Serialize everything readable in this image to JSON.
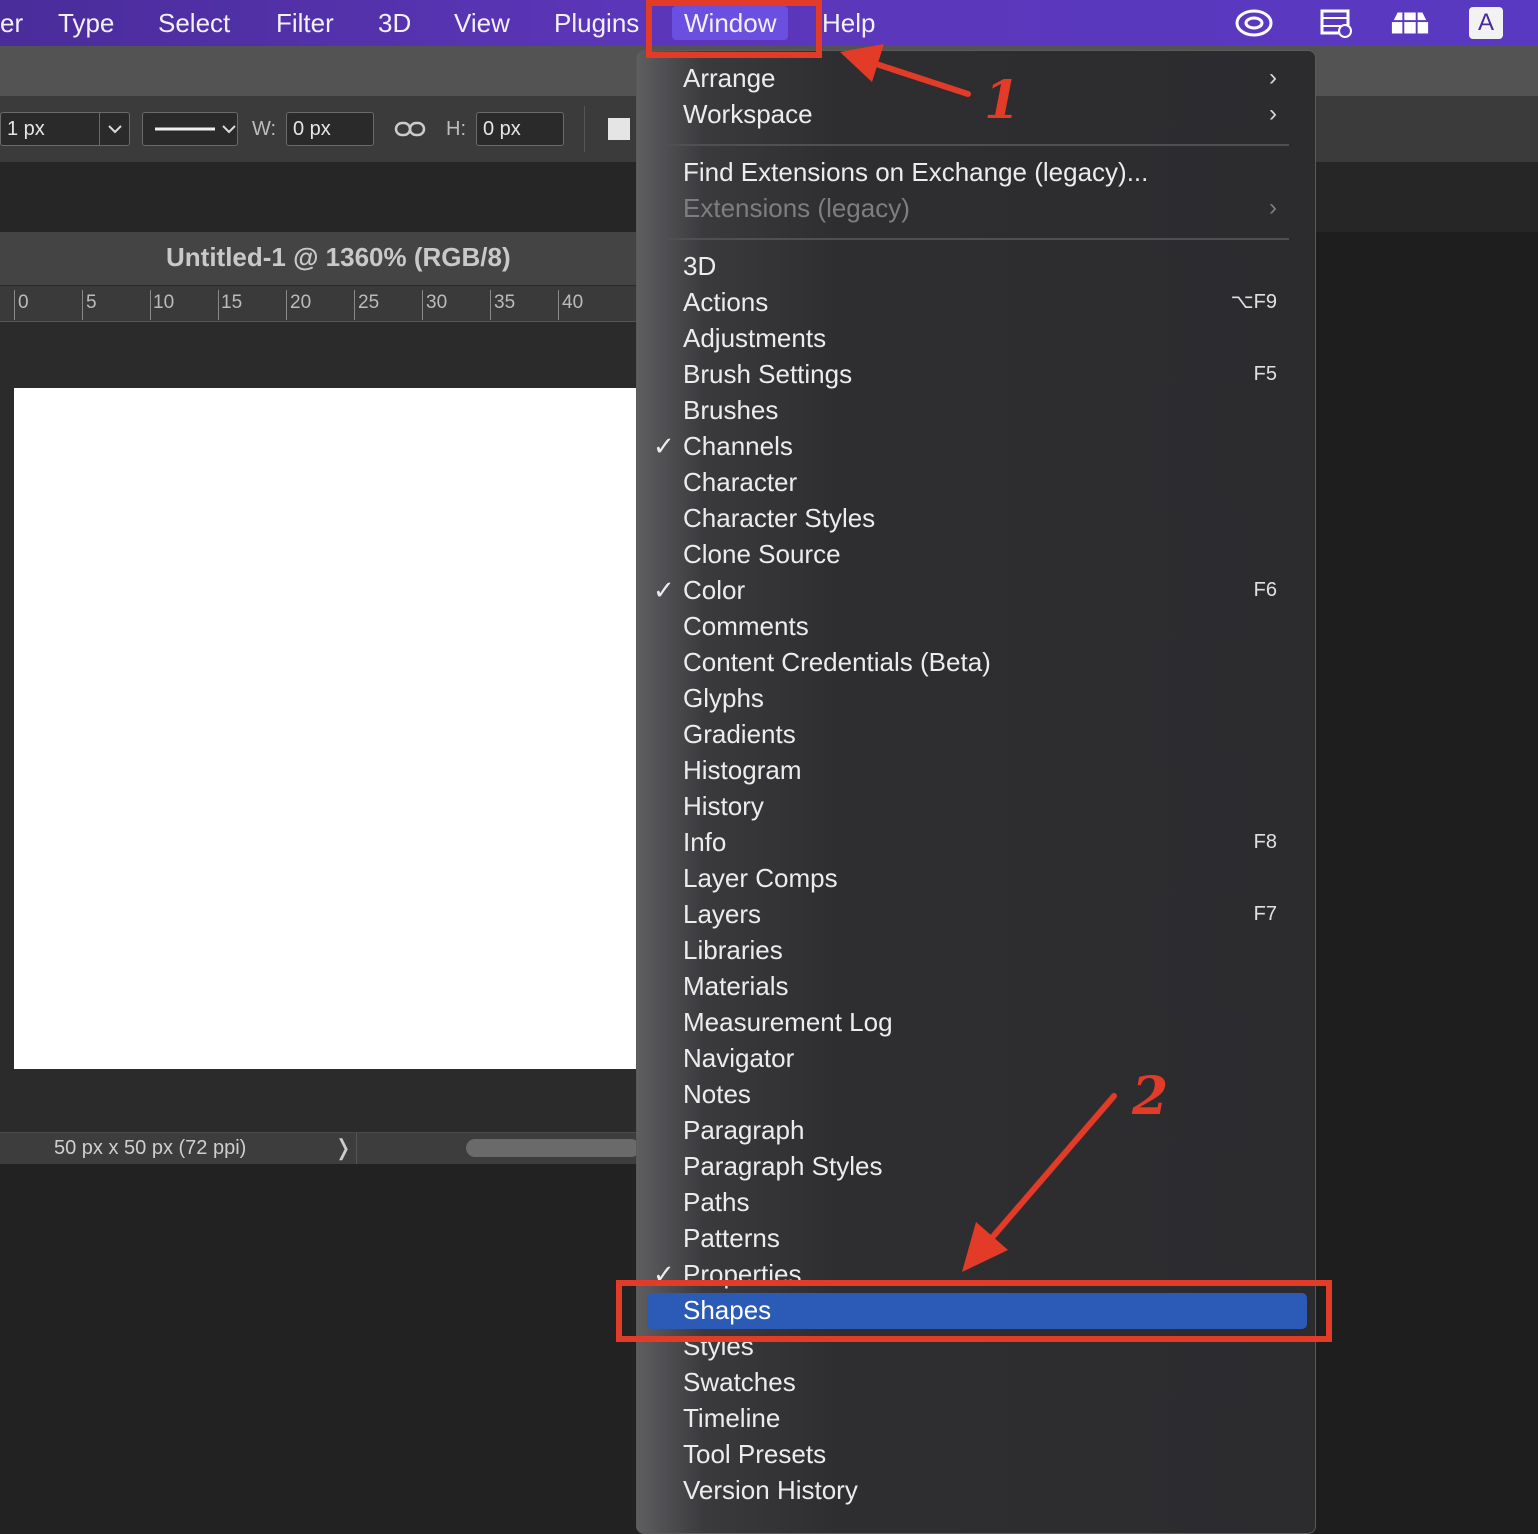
{
  "menubar": {
    "items": [
      "er",
      "Type",
      "Select",
      "Filter",
      "3D",
      "View",
      "Plugins",
      "Window",
      "Help"
    ],
    "active": "Window",
    "tray_icons": [
      "creative-cloud-icon",
      "film-icon",
      "workspace-icon",
      "input-source-icon"
    ],
    "input_source": "A"
  },
  "options": {
    "stroke_width": "1 px",
    "w_label": "W:",
    "w_value": "0 px",
    "h_label": "H:",
    "h_value": "0 px"
  },
  "document": {
    "title": "Untitled-1 @ 1360% (RGB/8)",
    "ruler_ticks": [
      "0",
      "5",
      "10",
      "15",
      "20",
      "25",
      "30",
      "35",
      "40"
    ],
    "status": "50 px x 50 px (72 ppi)"
  },
  "menu": {
    "section1": [
      {
        "label": "Arrange",
        "submenu": true
      },
      {
        "label": "Workspace",
        "submenu": true
      }
    ],
    "section2": [
      {
        "label": "Find Extensions on Exchange (legacy)..."
      },
      {
        "label": "Extensions (legacy)",
        "submenu": true,
        "disabled": true
      }
    ],
    "items": [
      {
        "label": "3D"
      },
      {
        "label": "Actions",
        "shortcut": "⌥F9"
      },
      {
        "label": "Adjustments"
      },
      {
        "label": "Brush Settings",
        "shortcut": "F5"
      },
      {
        "label": "Brushes"
      },
      {
        "label": "Channels",
        "checked": true
      },
      {
        "label": "Character"
      },
      {
        "label": "Character Styles"
      },
      {
        "label": "Clone Source"
      },
      {
        "label": "Color",
        "shortcut": "F6",
        "checked": true
      },
      {
        "label": "Comments"
      },
      {
        "label": "Content Credentials (Beta)"
      },
      {
        "label": "Glyphs"
      },
      {
        "label": "Gradients"
      },
      {
        "label": "Histogram"
      },
      {
        "label": "History"
      },
      {
        "label": "Info",
        "shortcut": "F8"
      },
      {
        "label": "Layer Comps"
      },
      {
        "label": "Layers",
        "shortcut": "F7"
      },
      {
        "label": "Libraries"
      },
      {
        "label": "Materials"
      },
      {
        "label": "Measurement Log"
      },
      {
        "label": "Navigator"
      },
      {
        "label": "Notes"
      },
      {
        "label": "Paragraph"
      },
      {
        "label": "Paragraph Styles"
      },
      {
        "label": "Paths"
      },
      {
        "label": "Patterns"
      },
      {
        "label": "Properties",
        "checked": true
      },
      {
        "label": "Shapes",
        "highlighted": true
      },
      {
        "label": "Styles"
      },
      {
        "label": "Swatches"
      },
      {
        "label": "Timeline"
      },
      {
        "label": "Tool Presets"
      },
      {
        "label": "Version History"
      }
    ]
  },
  "annotations": {
    "step1": "1",
    "step2": "2",
    "color": "#e23b27"
  },
  "colors": {
    "menubar": "#5a39c2",
    "highlight": "#2c5ab7",
    "menu_bg": "#2c2c2f"
  }
}
